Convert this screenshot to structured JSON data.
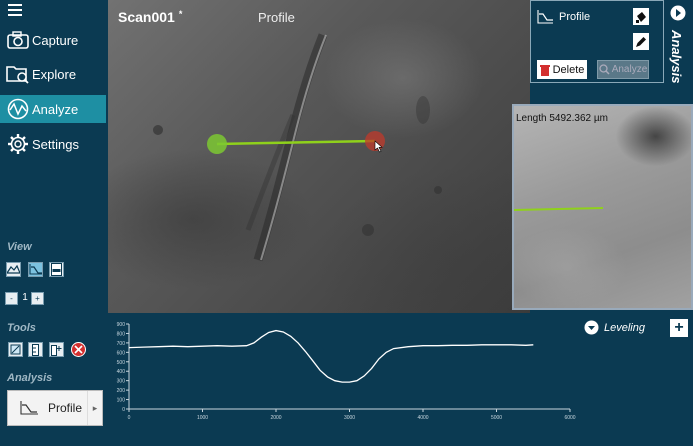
{
  "sidebar": {
    "nav": [
      {
        "label": "Capture",
        "icon": "camera-icon"
      },
      {
        "label": "Explore",
        "icon": "folder-search-icon"
      },
      {
        "label": "Analyze",
        "icon": "analyze-wave-icon",
        "active": true
      },
      {
        "label": "Settings",
        "icon": "gear-icon"
      }
    ],
    "view_title": "View",
    "zoom_value": "1",
    "zoom_minus": "-",
    "zoom_plus": "+",
    "tools_title": "Tools",
    "analysis_title": "Analysis",
    "analysis_button": "Profile"
  },
  "scan": {
    "title": "Scan001",
    "title_marker": "*",
    "mode": "Profile"
  },
  "profile_panel": {
    "name": "Profile",
    "delete_label": "Delete",
    "analyze_label": "Analyze"
  },
  "side_tab": {
    "label": "Analysis"
  },
  "zoom_view": {
    "length": "Length   5492.362 µm"
  },
  "leveling": {
    "label": "Leveling"
  },
  "plus_label": "+",
  "colors": {
    "accent": "#1e8fa3",
    "background": "#0b3a52",
    "profile_line": "#8fd11b",
    "start_marker": "#7cc832",
    "end_marker": "#c0392b"
  },
  "chart_data": {
    "type": "line",
    "xlim": [
      0,
      6000
    ],
    "ylim": [
      0,
      900
    ],
    "xticks": [
      0,
      1000,
      2000,
      3000,
      4000,
      5000,
      6000
    ],
    "yticks": [
      0,
      100,
      200,
      300,
      400,
      500,
      600,
      700,
      800,
      900
    ],
    "series": [
      {
        "x": [
          0,
          200,
          400,
          600,
          800,
          1000,
          1200,
          1400,
          1600,
          1700,
          1800,
          1900,
          2000,
          2100,
          2200,
          2300,
          2400,
          2500,
          2600,
          2700,
          2800,
          2900,
          3000,
          3100,
          3200,
          3300,
          3400,
          3500,
          3600,
          3800,
          4000,
          4200,
          4400,
          4600,
          4800,
          5000,
          5200,
          5400,
          5500
        ],
        "y": [
          650,
          655,
          660,
          665,
          660,
          665,
          670,
          665,
          670,
          700,
          760,
          810,
          830,
          815,
          770,
          700,
          610,
          510,
          410,
          340,
          300,
          285,
          285,
          300,
          350,
          430,
          530,
          600,
          640,
          660,
          670,
          670,
          675,
          675,
          680,
          680,
          680,
          675,
          680
        ]
      }
    ]
  }
}
